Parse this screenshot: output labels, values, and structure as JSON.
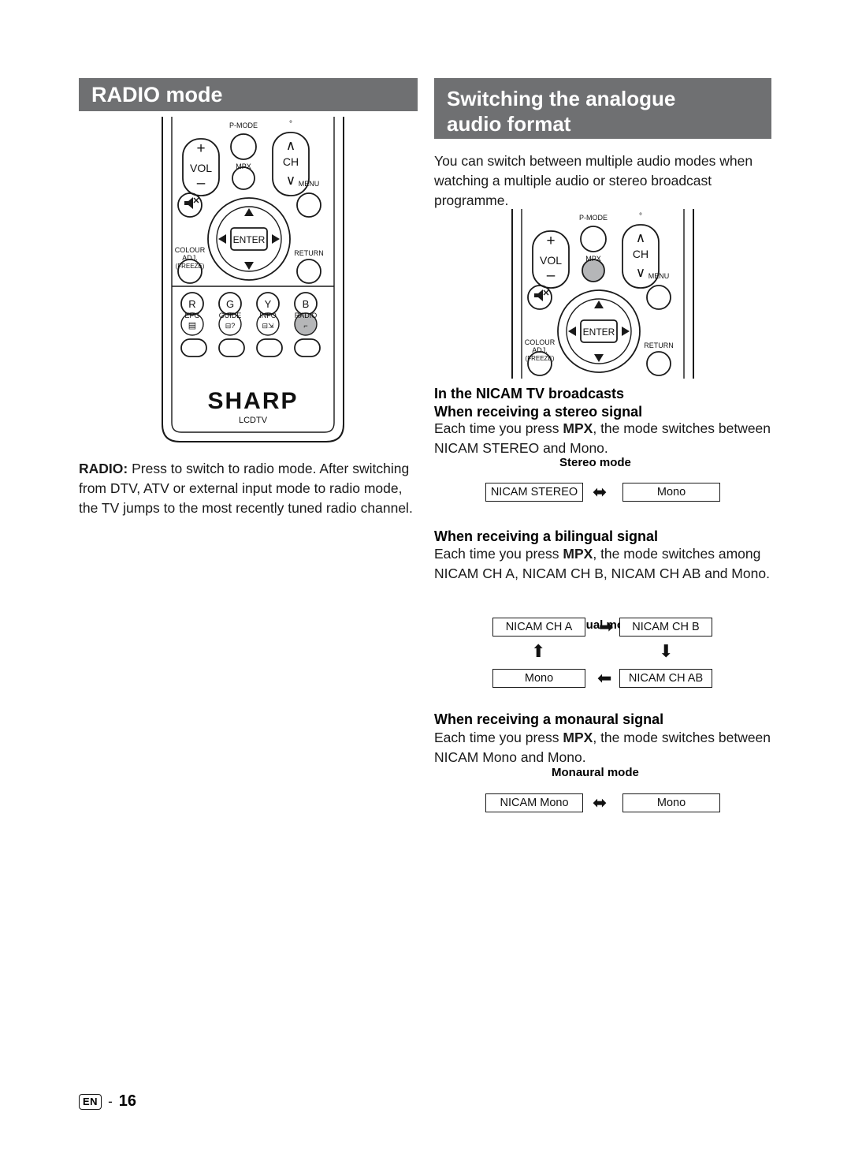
{
  "page": {
    "footer_locale": "EN",
    "footer_dash": "-",
    "footer_number": "16"
  },
  "left": {
    "section_title": "RADIO mode",
    "caption_lead": "RADIO:",
    "caption_text": " Press to switch to radio mode. After switching from DTV, ATV or external input mode to radio mode, the TV jumps to the most recently tuned radio channel."
  },
  "right": {
    "section_title_line1": "Switching the analogue",
    "section_title_line2": "audio format",
    "intro": "You can switch between multiple audio modes when watching a multiple audio or stereo broadcast programme.",
    "heading_nicam": "In the NICAM TV broadcasts",
    "heading_stereo": "When receiving a stereo signal",
    "stereo_text_a": "Each time you press ",
    "stereo_text_mpx": "MPX",
    "stereo_text_b": ", the mode switches between NICAM STEREO and Mono.",
    "stereo_mode_label": "Stereo mode",
    "stereo_box_1": "NICAM STEREO",
    "stereo_box_2": "Mono",
    "heading_bilingual": "When receiving a bilingual signal",
    "bilingual_text_a": "Each time you press ",
    "bilingual_text_mpx": "MPX",
    "bilingual_text_b": ", the mode switches among NICAM CH A, NICAM CH B, NICAM CH AB and Mono.",
    "bilingual_mode_label": "Bilingual mode",
    "bilingual_box_1": "NICAM CH A",
    "bilingual_box_2": "NICAM CH B",
    "bilingual_box_3": "Mono",
    "bilingual_box_4": "NICAM CH AB",
    "heading_monaural": "When receiving a monaural signal",
    "monaural_text_a": "Each time you press ",
    "monaural_text_mpx": "MPX",
    "monaural_text_b": ", the mode switches between NICAM Mono and Mono.",
    "monaural_mode_label": "Monaural mode",
    "monaural_box_1": "NICAM Mono",
    "monaural_box_2": "Mono"
  },
  "remote": {
    "labels": {
      "vol_plus": "+",
      "vol": "VOL",
      "vol_minus": "–",
      "p_mode": "P-MODE",
      "mpx": "MPX",
      "ch_up": "∧",
      "ch": "CH",
      "ch_down": "∨",
      "ch_dot": "°",
      "menu": "MENU",
      "enter": "ENTER",
      "colour": "COLOUR",
      "adj": "ADJ.",
      "freeze": "(FREEZE)",
      "return": "RETURN",
      "r": "R",
      "g": "G",
      "y": "Y",
      "b": "B",
      "epg": "EPG",
      "guide": "GUIDE",
      "info": "INFO",
      "radio": "RADIO",
      "brand": "SHARP",
      "sub_brand": "LCDTV"
    }
  }
}
